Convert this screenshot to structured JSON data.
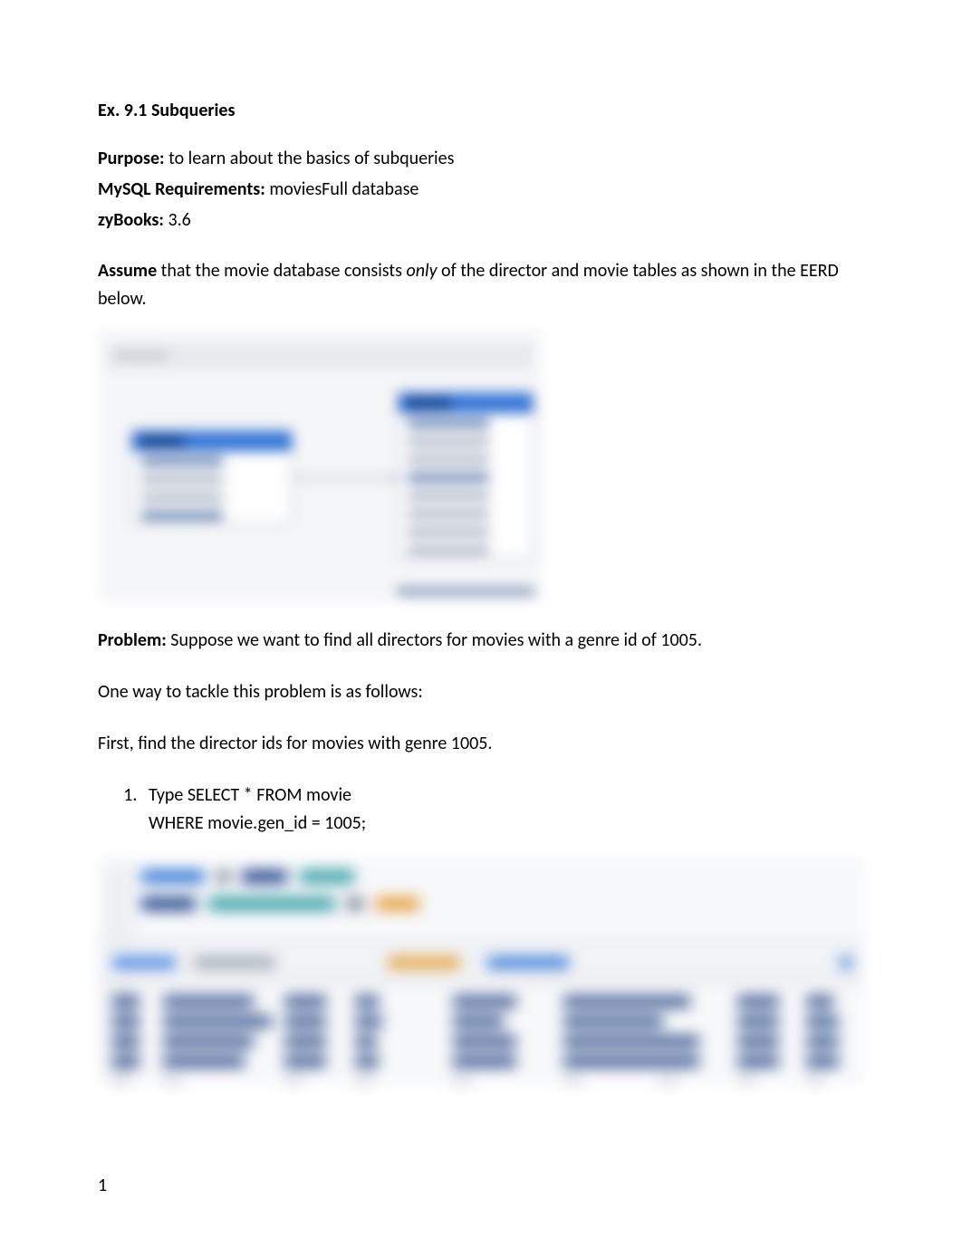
{
  "title": "Ex. 9.1 Subqueries",
  "purpose_label": "Purpose:",
  "purpose_text": " to learn about the basics of subqueries",
  "mysql_label": "MySQL Requirements:",
  "mysql_text": " moviesFull database",
  "zybooks_label": "zyBooks:",
  "zybooks_text": " 3.6",
  "assume_label": "Assume",
  "assume_pre": " that the movie database consists ",
  "assume_only": "only",
  "assume_post": " of the director and movie tables as shown in the EERD below.",
  "problem_label": "Problem:",
  "problem_text": " Suppose we want to find all directors for movies with a genre id of 1005.",
  "approach_text": "One way to tackle this problem is as follows:",
  "first_text": "First, find the director ids for movies with genre 1005.",
  "step1_line1": "Type SELECT * FROM movie",
  "step1_line2": "WHERE movie.gen_id = 1005;",
  "page_number": "1"
}
